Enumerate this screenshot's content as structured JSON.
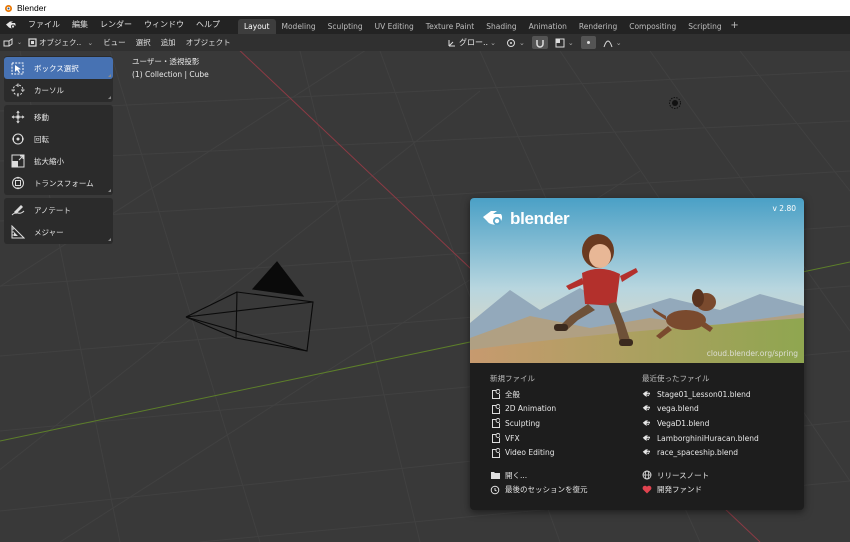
{
  "window": {
    "title": "Blender"
  },
  "menu": [
    "ファイル",
    "編集",
    "レンダー",
    "ウィンドウ",
    "ヘルプ"
  ],
  "workspaces": [
    {
      "label": "Layout",
      "active": true
    },
    {
      "label": "Modeling",
      "active": false
    },
    {
      "label": "Sculpting",
      "active": false
    },
    {
      "label": "UV Editing",
      "active": false
    },
    {
      "label": "Texture Paint",
      "active": false
    },
    {
      "label": "Shading",
      "active": false
    },
    {
      "label": "Animation",
      "active": false
    },
    {
      "label": "Rendering",
      "active": false
    },
    {
      "label": "Compositing",
      "active": false
    },
    {
      "label": "Scripting",
      "active": false
    }
  ],
  "viewport_header": {
    "mode": "オブジェク..",
    "menus": [
      "ビュー",
      "選択",
      "追加",
      "オブジェクト"
    ],
    "transform_orientation": "グロー.."
  },
  "viewport": {
    "view_name": "ユーザー・透視投影",
    "collection_info": "(1) Collection | Cube"
  },
  "toolbar": {
    "groups": [
      [
        {
          "label": "ボックス選択",
          "icon": "box-select-icon",
          "active": true
        },
        {
          "label": "カーソル",
          "icon": "cursor-icon",
          "active": false
        }
      ],
      [
        {
          "label": "移動",
          "icon": "move-icon",
          "active": false
        },
        {
          "label": "回転",
          "icon": "rotate-icon",
          "active": false
        },
        {
          "label": "拡大縮小",
          "icon": "scale-icon",
          "active": false
        },
        {
          "label": "トランスフォーム",
          "icon": "transform-icon",
          "active": false
        }
      ],
      [
        {
          "label": "アノテート",
          "icon": "annotate-icon",
          "active": false
        },
        {
          "label": "メジャー",
          "icon": "measure-icon",
          "active": false
        }
      ]
    ]
  },
  "splash": {
    "logo_text": "blender",
    "version": "v 2.80",
    "credit": "cloud.blender.org/spring",
    "new_file_heading": "新規ファイル",
    "new_file_items": [
      "全般",
      "2D Animation",
      "Sculpting",
      "VFX",
      "Video Editing"
    ],
    "recent_heading": "最近使ったファイル",
    "recent_items": [
      "Stage01_Lesson01.blend",
      "vega.blend",
      "VegaD1.blend",
      "LamborghiniHuracan.blend",
      "race_spaceship.blend"
    ],
    "open_label": "開く...",
    "recover_label": "最後のセッションを復元",
    "release_notes_label": "リリースノート",
    "fund_label": "開発ファンド"
  },
  "colors": {
    "accent": "#4772b3",
    "background": "#393939",
    "x_axis": "#9a3b47",
    "y_axis": "#6b8e23",
    "fund_heart": "#e0434f"
  }
}
